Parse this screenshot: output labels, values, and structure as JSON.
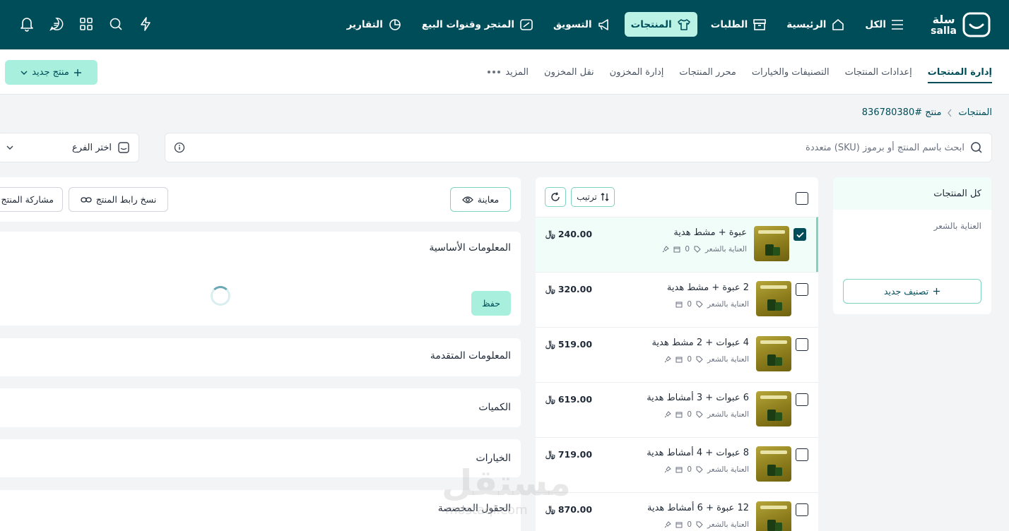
{
  "brand": {
    "name_ar": "سلة",
    "name_en": "salla"
  },
  "nav": [
    {
      "label": "الكل",
      "icon": "menu-icon"
    },
    {
      "label": "الرئيسية",
      "icon": "home-icon"
    },
    {
      "label": "الطلبات",
      "icon": "box-icon"
    },
    {
      "label": "المنتجات",
      "icon": "shirt-icon",
      "active": true
    },
    {
      "label": "التسويق",
      "icon": "megaphone-icon"
    },
    {
      "label": "المتجر وقنوات البيع",
      "icon": "store-icon"
    },
    {
      "label": "التقارير",
      "icon": "pie-chart-icon"
    }
  ],
  "tabs": [
    {
      "label": "إدارة المنتجات",
      "active": true
    },
    {
      "label": "إعدادات المنتجات"
    },
    {
      "label": "التصنيفات والخيارات"
    },
    {
      "label": "محرر المنتجات"
    },
    {
      "label": "إدارة المخزون"
    },
    {
      "label": "نقل المخزون"
    },
    {
      "label": "المزيد"
    }
  ],
  "new_product_label": "منتج جديد",
  "breadcrumb": {
    "root": "المنتجات",
    "current": "منتج #836780380"
  },
  "search": {
    "placeholder": "ابحث باسم المنتج أو برموز (SKU) متعددة"
  },
  "branch": {
    "label": "اختر الفرع"
  },
  "categories": {
    "all_label": "كل المنتجات",
    "items": [
      "العناية بالشعر"
    ],
    "add_label": "تصنيف جديد"
  },
  "list": {
    "sort_label": "ترتيب"
  },
  "products": [
    {
      "name": "عبوة + مشط هدية",
      "price": "240.00",
      "count": "0",
      "category": "العناية بالشعر",
      "selected": true
    },
    {
      "name": "2 عبوة + مشط هدية",
      "price": "320.00",
      "count": "0",
      "category": "العناية بالشعر"
    },
    {
      "name": "4 عبوات + 2 مشط هدية",
      "price": "519.00",
      "count": "0",
      "category": "العناية بالشعر"
    },
    {
      "name": "6 عبوات + 3 أمشاط هدية",
      "price": "619.00",
      "count": "0",
      "category": "العناية بالشعر"
    },
    {
      "name": "8 عبوات + 4 أمشاط هدية",
      "price": "719.00",
      "count": "0",
      "category": "العناية بالشعر"
    },
    {
      "name": "12 عبوة + 6 أمشاط هدية",
      "price": "870.00",
      "count": "0",
      "category": "العناية بالشعر"
    }
  ],
  "editor": {
    "preview_label": "معاينة",
    "copy_link_label": "نسخ رابط المنتج",
    "share_label": "مشاركة المنتج",
    "save_label": "حفظ",
    "sections": [
      "المعلومات الأساسية",
      "المعلومات المتقدمة",
      "الكميات",
      "الخيارات",
      "الحقول المخصصة"
    ]
  },
  "watermark": {
    "ar": "مستقل",
    "en": "mostaql.com"
  },
  "colors": {
    "primary": "#004d5a",
    "accent": "#baf3e6",
    "selected_row": "#f0fdf9"
  }
}
